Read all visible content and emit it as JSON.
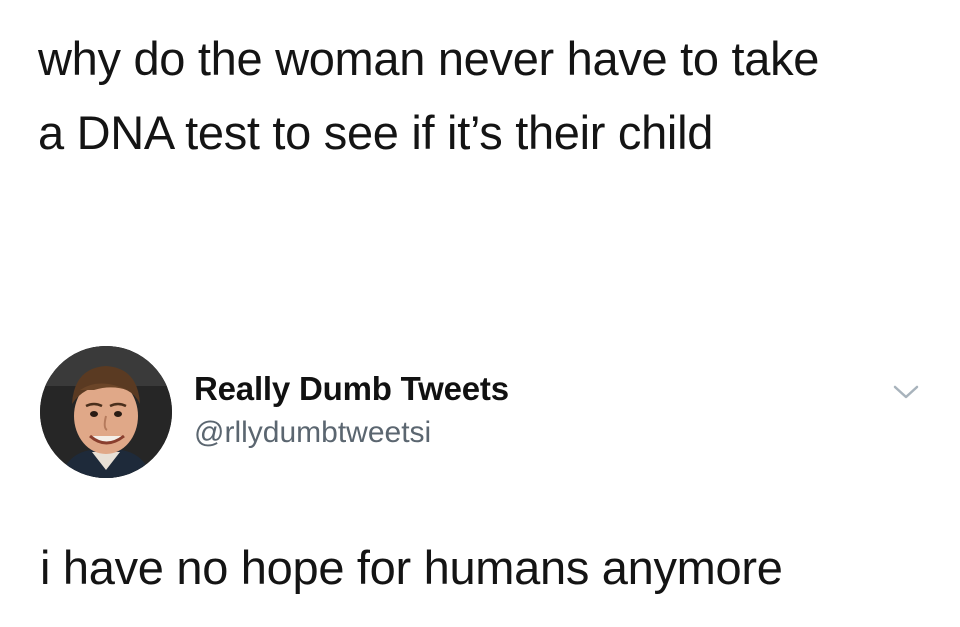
{
  "quoted": {
    "line1": "why do the woman never have to take",
    "line2": "a DNA test to see if it’s their child"
  },
  "tweet": {
    "author_name": "Really Dumb Tweets",
    "author_handle": "@rllydumbtweetsi",
    "text": "i have no hope for humans anymore"
  },
  "icons": {
    "caret": "chevron-down-icon",
    "avatar": "avatar"
  },
  "colors": {
    "text": "#141414",
    "handle": "#5b6670",
    "caret": "#a8b3bc"
  }
}
